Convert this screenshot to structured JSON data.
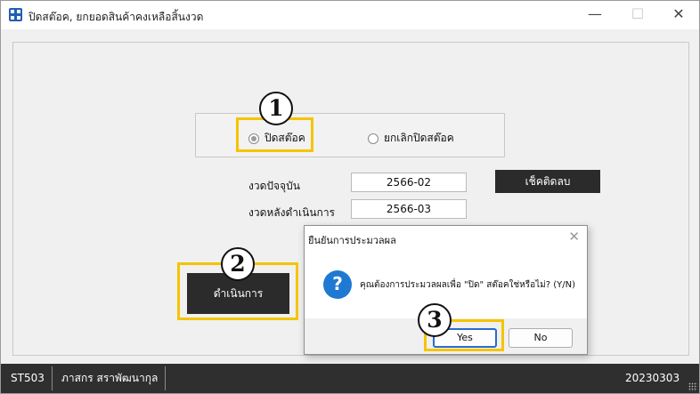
{
  "window": {
    "title": "ปิดสต๊อค, ยกยอดสินค้าคงเหลือสิ้นงวด",
    "icon": "grid-app-icon",
    "controls": {
      "minimize": "—",
      "maximize": "☐",
      "close": "✕"
    }
  },
  "options": {
    "close_stock": "ปิดสต๊อค",
    "cancel_close_stock": "ยกเลิกปิดสต๊อค",
    "selected": "close_stock"
  },
  "fields": {
    "current_period_label": "งวดปัจจุบัน",
    "current_period_value": "2566-02",
    "next_period_label": "งวดหลังดำเนินการ",
    "next_period_value": "2566-03",
    "check_negative_button": "เช็คติดลบ"
  },
  "process_button": "ดำเนินการ",
  "annotations": {
    "step1": "1",
    "step2": "2",
    "step3": "3",
    "highlight_color": "#f5c400"
  },
  "dialog": {
    "title": "ยืนยันการประมวลผล",
    "close": "✕",
    "icon": "question-icon",
    "icon_glyph": "?",
    "message": "คุณต้องการประมวลผลเพื่อ \"ปิด\" สต๊อคใช่หรือไม่? (Y/N)",
    "yes": "Yes",
    "no": "No"
  },
  "status": {
    "code": "ST503",
    "user": "ภาสกร สราพัฒนากุล",
    "date": "20230303"
  },
  "colors": {
    "accent": "#2a6ad1",
    "dark_button": "#2b2b2b",
    "statusbar": "#2f2f2f"
  }
}
